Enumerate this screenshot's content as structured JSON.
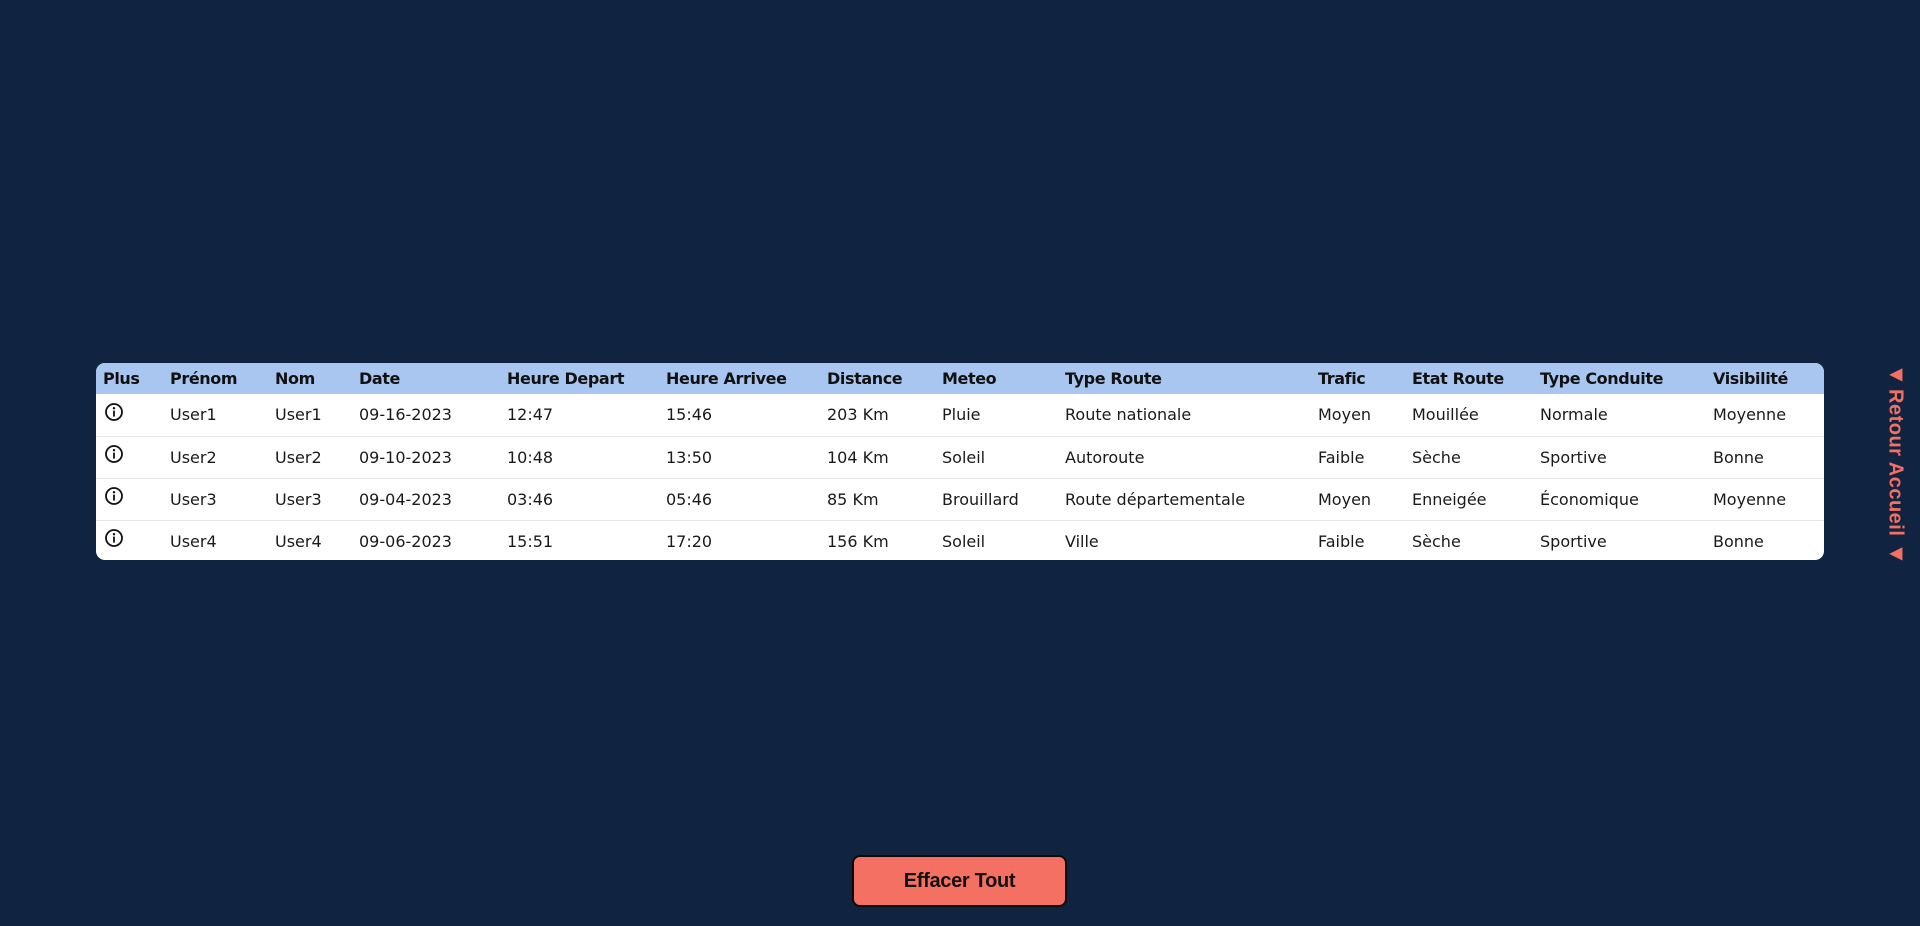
{
  "table": {
    "headers": {
      "plus": "Plus",
      "prenom": "Prénom",
      "nom": "Nom",
      "date": "Date",
      "heure_depart": "Heure Depart",
      "heure_arrivee": "Heure Arrivee",
      "distance": "Distance",
      "meteo": "Meteo",
      "type_route": "Type Route",
      "trafic": "Trafic",
      "etat_route": "Etat Route",
      "type_conduite": "Type Conduite",
      "visibilite": "Visibilité"
    },
    "rows": [
      {
        "prenom": "User1",
        "nom": "User1",
        "date": "09-16-2023",
        "heure_depart": "12:47",
        "heure_arrivee": "15:46",
        "distance": "203 Km",
        "meteo": "Pluie",
        "type_route": "Route nationale",
        "trafic": "Moyen",
        "etat_route": "Mouillée",
        "type_conduite": "Normale",
        "visibilite": "Moyenne"
      },
      {
        "prenom": "User2",
        "nom": "User2",
        "date": "09-10-2023",
        "heure_depart": "10:48",
        "heure_arrivee": "13:50",
        "distance": "104 Km",
        "meteo": "Soleil",
        "type_route": "Autoroute",
        "trafic": "Faible",
        "etat_route": "Sèche",
        "type_conduite": "Sportive",
        "visibilite": "Bonne"
      },
      {
        "prenom": "User3",
        "nom": "User3",
        "date": "09-04-2023",
        "heure_depart": "03:46",
        "heure_arrivee": "05:46",
        "distance": "85 Km",
        "meteo": "Brouillard",
        "type_route": "Route départementale",
        "trafic": "Moyen",
        "etat_route": "Enneigée",
        "type_conduite": "Économique",
        "visibilite": "Moyenne"
      },
      {
        "prenom": "User4",
        "nom": "User4",
        "date": "09-06-2023",
        "heure_depart": "15:51",
        "heure_arrivee": "17:20",
        "distance": "156 Km",
        "meteo": "Soleil",
        "type_route": "Ville",
        "trafic": "Faible",
        "etat_route": "Sèche",
        "type_conduite": "Sportive",
        "visibilite": "Bonne"
      }
    ],
    "row_icon": "info-circle-icon"
  },
  "back_link": {
    "label": "Retour Accueil",
    "arrow_icon": "triangle-left-icon"
  },
  "clear_button": {
    "label": "Effacer Tout"
  },
  "colors": {
    "background": "#102442",
    "table_header": "#a8c6f0",
    "accent": "#f47062"
  }
}
